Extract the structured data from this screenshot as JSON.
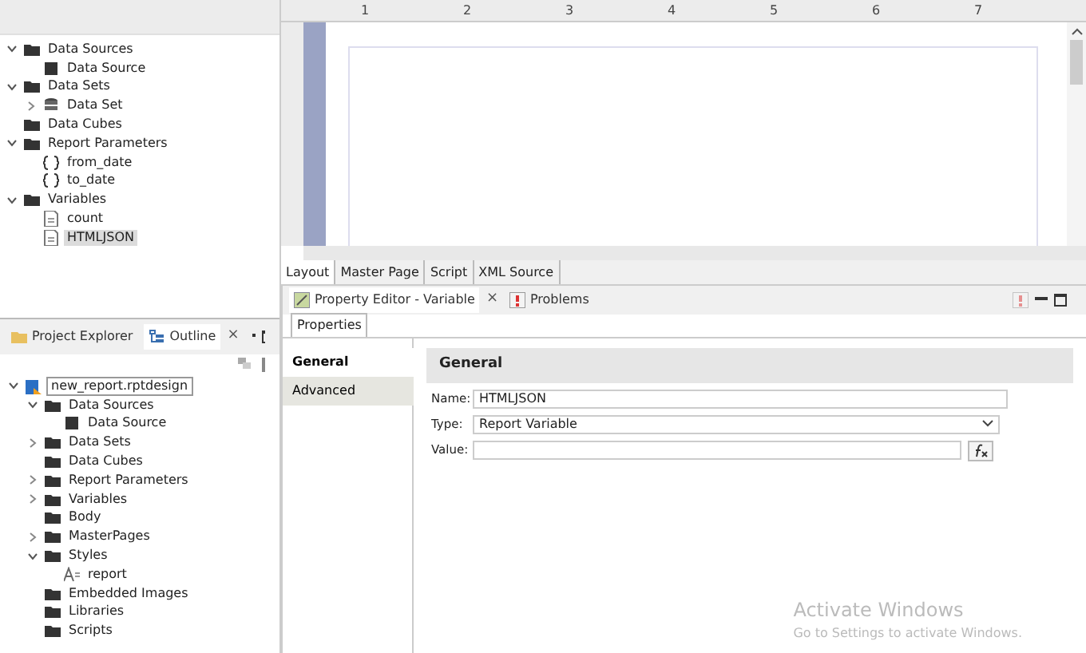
{
  "data_explorer": {
    "tree": [
      {
        "label": "Data Sources",
        "kind": "folder",
        "expanded": true,
        "children": [
          {
            "label": "Data Source",
            "kind": "datasource"
          }
        ]
      },
      {
        "label": "Data Sets",
        "kind": "folder",
        "expanded": true,
        "children": [
          {
            "label": "Data Set",
            "kind": "dataset",
            "expanded": false
          }
        ]
      },
      {
        "label": "Data Cubes",
        "kind": "folder"
      },
      {
        "label": "Report Parameters",
        "kind": "folder",
        "expanded": true,
        "children": [
          {
            "label": "from_date",
            "kind": "param"
          },
          {
            "label": "to_date",
            "kind": "param"
          }
        ]
      },
      {
        "label": "Variables",
        "kind": "folder",
        "expanded": true,
        "children": [
          {
            "label": "count",
            "kind": "variable",
            "selected": false
          },
          {
            "label": "HTMLJSON",
            "kind": "variable",
            "selected": true
          }
        ]
      }
    ]
  },
  "outline_panel": {
    "tabs": [
      {
        "label": "Project Explorer",
        "kind": "project",
        "selected": false
      },
      {
        "label": "Outline",
        "kind": "outline",
        "selected": true,
        "close": "×"
      }
    ],
    "tree": [
      {
        "label": "new_report.rptdesign",
        "kind": "report",
        "expanded": true,
        "selected": true,
        "children": [
          {
            "label": "Data Sources",
            "kind": "folder",
            "expanded": true,
            "children": [
              {
                "label": "Data Source",
                "kind": "datasource"
              }
            ]
          },
          {
            "label": "Data Sets",
            "kind": "folder",
            "expanded": false
          },
          {
            "label": "Data Cubes",
            "kind": "folder"
          },
          {
            "label": "Report Parameters",
            "kind": "folder",
            "expanded": false
          },
          {
            "label": "Variables",
            "kind": "folder",
            "expanded": false
          },
          {
            "label": "Body",
            "kind": "folder"
          },
          {
            "label": "MasterPages",
            "kind": "folder",
            "expanded": false
          },
          {
            "label": "Styles",
            "kind": "folder",
            "expanded": true,
            "children": [
              {
                "label": "report",
                "kind": "style"
              }
            ]
          },
          {
            "label": "Embedded Images",
            "kind": "folder"
          },
          {
            "label": "Libraries",
            "kind": "folder"
          },
          {
            "label": "Scripts",
            "kind": "folder"
          }
        ]
      }
    ]
  },
  "editor": {
    "ruler_labels": [
      "1",
      "2",
      "3",
      "4",
      "5",
      "6",
      "7"
    ],
    "tabs": [
      {
        "label": "Layout",
        "selected": true
      },
      {
        "label": "Master Page",
        "selected": false
      },
      {
        "label": "Script",
        "selected": false
      },
      {
        "label": "XML Source",
        "selected": false
      }
    ]
  },
  "property_panel": {
    "tabs": [
      {
        "label": "Property Editor - Variable",
        "kind": "editor",
        "selected": true,
        "close": "×"
      },
      {
        "label": "Problems",
        "kind": "problems",
        "selected": false
      }
    ],
    "subtab": "Properties",
    "categories": [
      {
        "label": "General",
        "selected": true
      },
      {
        "label": "Advanced",
        "selected": false
      }
    ],
    "section_title": "General",
    "fields": [
      {
        "kind": "text",
        "label": "Name:",
        "value": "HTMLJSON"
      },
      {
        "kind": "select",
        "label": "Type:",
        "value": "Report Variable"
      },
      {
        "kind": "expression",
        "label": "Value:"
      }
    ]
  },
  "activation_notice": {
    "title": "Activate Windows",
    "message": "Go to Settings to activate Windows."
  }
}
